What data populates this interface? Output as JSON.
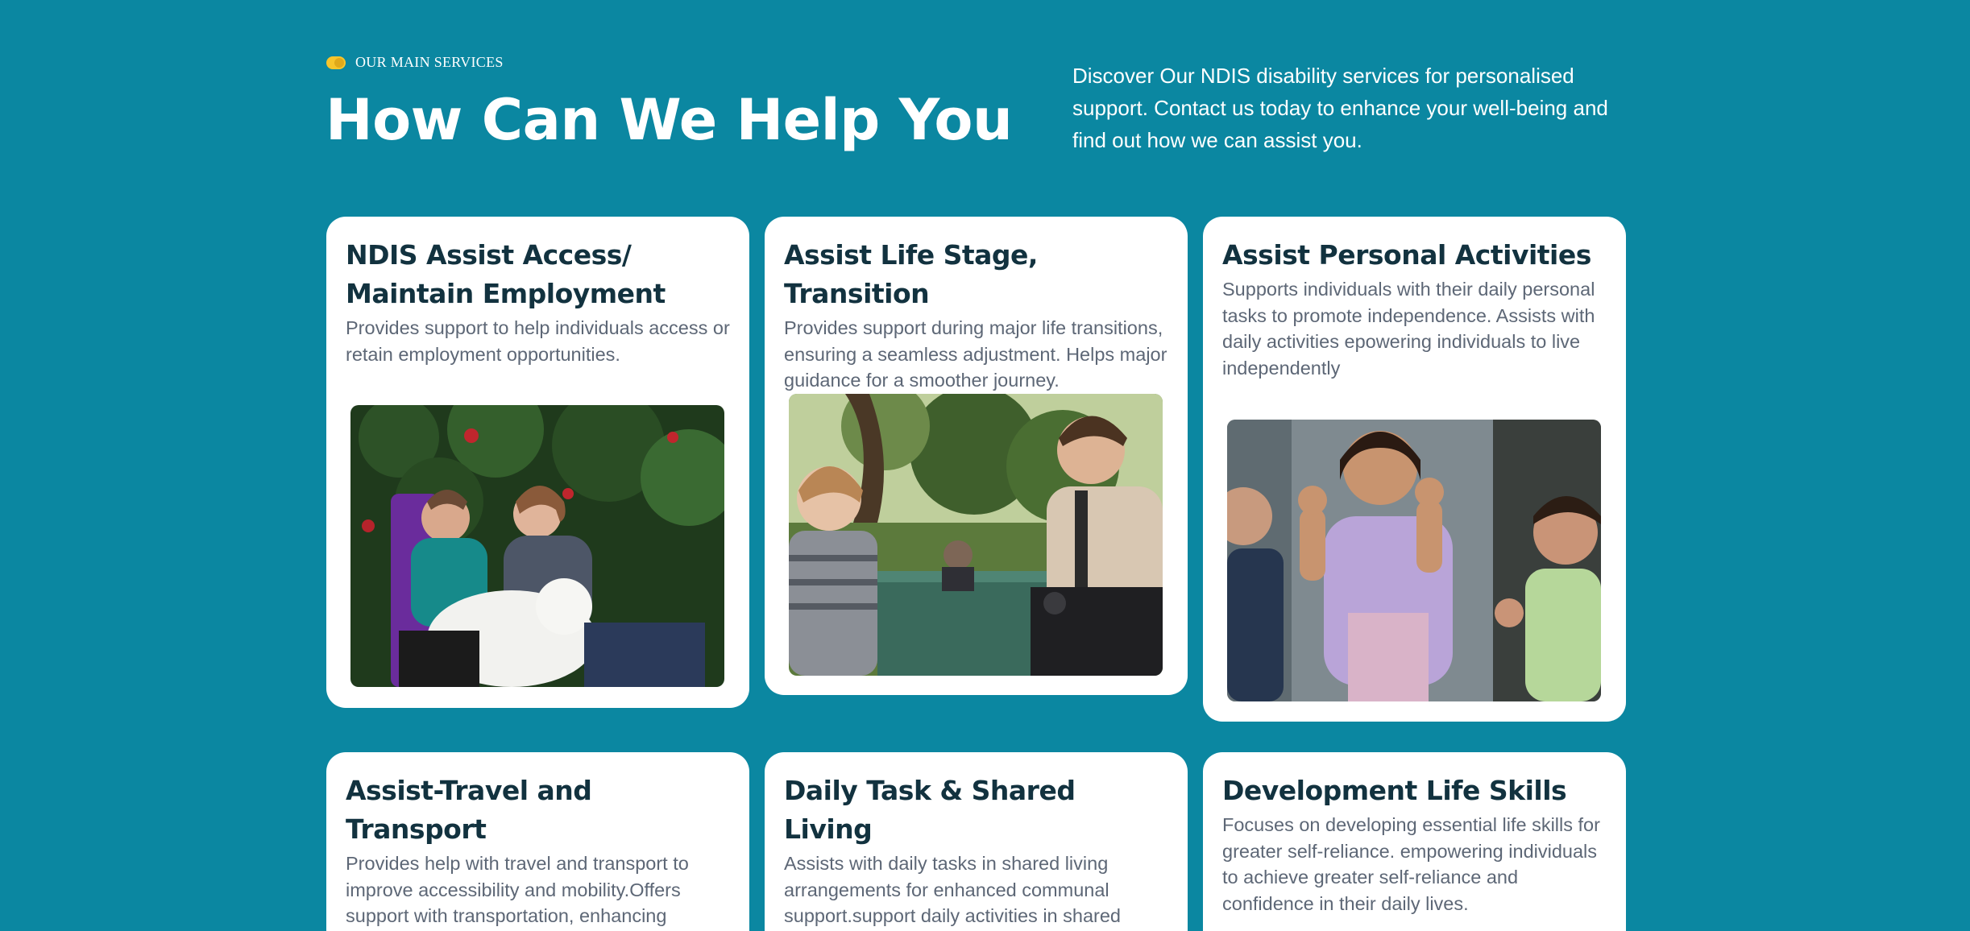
{
  "header": {
    "eyebrow": "OUR MAIN SERVICES",
    "title": "How Can We Help You",
    "intro": "Discover Our NDIS disability services for personalised support. Contact us today to enhance your well-being and find out how we can assist you."
  },
  "colors": {
    "background": "#0b87a1",
    "card": "#ffffff",
    "heading": "#12323f",
    "body_text": "#5d6776",
    "accent": "#f7c52b"
  },
  "services": [
    {
      "title": "NDIS Assist Access/ Maintain Employment",
      "description": "Provides support to help individuals access or retain employment opportunities."
    },
    {
      "title": "Assist Life Stage, Transition",
      "description": "Provides support during major life transitions, ensuring a seamless adjustment. Helps major guidance for a smoother journey."
    },
    {
      "title": "Assist Personal Activities",
      "description": "Supports individuals with their daily personal tasks to promote independence. Assists with daily activities epowering individuals to live independently"
    },
    {
      "title": "Assist-Travel and Transport",
      "description": "Provides help with travel and transport to improve accessibility and mobility.Offers support with transportation, enhancing mobility and accessibility."
    },
    {
      "title": "Daily Task & Shared Living",
      "description": "Assists with daily tasks in shared living arrangements for enhanced communal support.support daily activities in shared living spaces, fostering community."
    },
    {
      "title": "Development Life Skills",
      "description": "Focuses on developing essential life skills for greater self-reliance. empowering individuals to achieve greater self-reliance and confidence in their daily lives."
    }
  ]
}
